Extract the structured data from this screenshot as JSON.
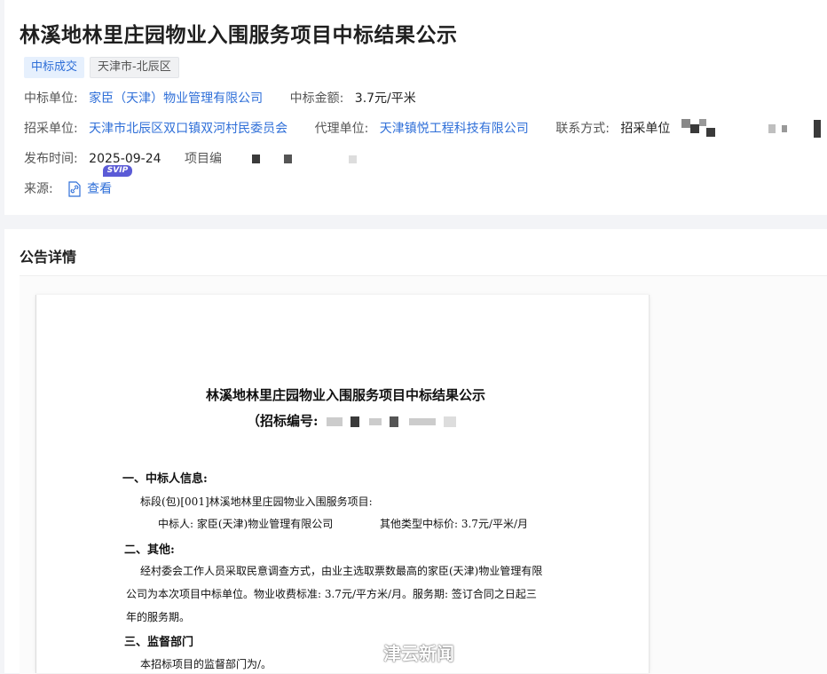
{
  "header": {
    "title": "林溪地林里庄园物业入围服务项目中标结果公示",
    "tags": [
      "中标成交",
      "天津市-北辰区"
    ]
  },
  "info": {
    "winner_label": "中标单位:",
    "winner_value": "家臣（天津）物业管理有限公司",
    "amount_label": "中标金额:",
    "amount_value": "3.7元/平米",
    "buyer_label": "招采单位:",
    "buyer_value": "天津市北辰区双口镇双河村民委员会",
    "agent_label": "代理单位:",
    "agent_value": "天津镇悦工程科技有限公司",
    "contact_label": "联系方式:",
    "contact_value": "招采单位",
    "date_label": "发布时间:",
    "date_value": "2025-09-24",
    "project_no_label": "项目编",
    "source_label": "来源:",
    "source_link": "查看",
    "svip_badge": "SVIP"
  },
  "detail": {
    "section_title": "公告详情"
  },
  "document": {
    "title": "林溪地林里庄园物业入围服务项目中标结果公示",
    "tender_no_label": "（招标编号:",
    "section1": "一、中标人信息:",
    "lot_line": "标段(包)[001]林溪地林里庄园物业入围服务项目:",
    "winner_line": "中标人: 家臣(天津)物业管理有限公司",
    "price_line": "其他类型中标价: 3.7元/平米/月",
    "section2": "二、其他:",
    "other_line1": "经村委会工作人员采取民意调查方式，由业主选取票数最高的家臣(天津)物业管理有限",
    "other_line2": "公司为本次项目中标单位。物业收费标准: 3.7元/平方米/月。服务期: 签订合同之日起三",
    "other_line3": "年的服务期。",
    "section3": "三、监督部门",
    "supervise_line": "本招标项目的监督部门为/。"
  },
  "watermark": {
    "text": "津云新闻",
    "logo": "weibo-icon"
  },
  "colors": {
    "link": "#2f6fd8",
    "tag_blue_bg": "#e6f0fd",
    "svip": "#5b5bd6"
  }
}
